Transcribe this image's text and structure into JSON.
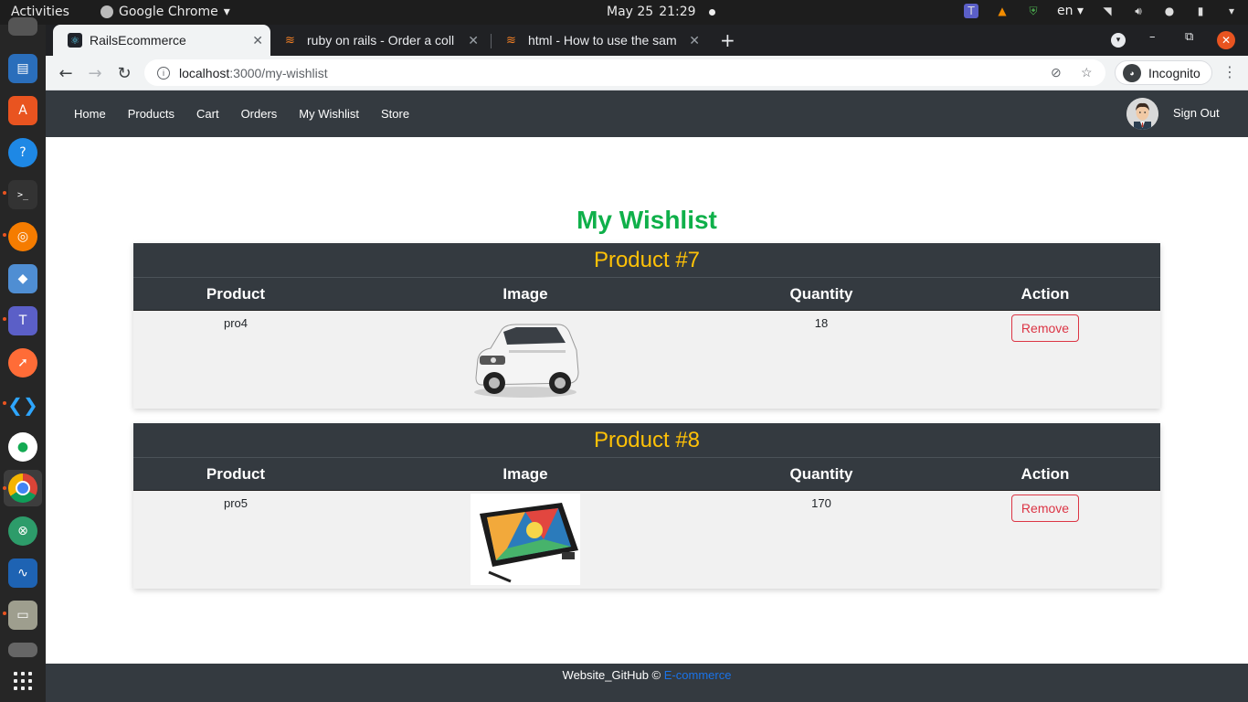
{
  "system": {
    "activities": "Activities",
    "app_menu": "Google Chrome",
    "date": "May 25",
    "time": "21:29",
    "language": "en"
  },
  "browser": {
    "tabs": [
      {
        "title": "RailsEcommerce",
        "active": true,
        "icon": "react-icon"
      },
      {
        "title": "ruby on rails - Order a coll",
        "active": false,
        "icon": "stackoverflow-icon"
      },
      {
        "title": "html - How to use the sam",
        "active": false,
        "icon": "stackoverflow-icon"
      }
    ],
    "url_host": "localhost",
    "url_path": ":3000/my-wishlist",
    "incognito_label": "Incognito"
  },
  "site": {
    "nav": [
      "Home",
      "Products",
      "Cart",
      "Orders",
      "My Wishlist",
      "Store"
    ],
    "sign_out": "Sign Out",
    "page_title": "My Wishlist",
    "columns": {
      "product": "Product",
      "image": "Image",
      "quantity": "Quantity",
      "action": "Action"
    },
    "items": [
      {
        "heading": "Product #7",
        "product": "pro4",
        "image": "white-suv-car",
        "quantity": "18",
        "action": "Remove"
      },
      {
        "heading": "Product #8",
        "product": "pro5",
        "image": "drawing-tablet",
        "quantity": "170",
        "action": "Remove"
      }
    ],
    "footer_text": "Website_GitHub ©",
    "footer_link": "E-commerce"
  },
  "colors": {
    "navbar": "#343a40",
    "title_green": "#0fb04a",
    "heading_yellow": "#ffc107",
    "remove_red": "#dc3545",
    "link_blue": "#1a73e8"
  }
}
